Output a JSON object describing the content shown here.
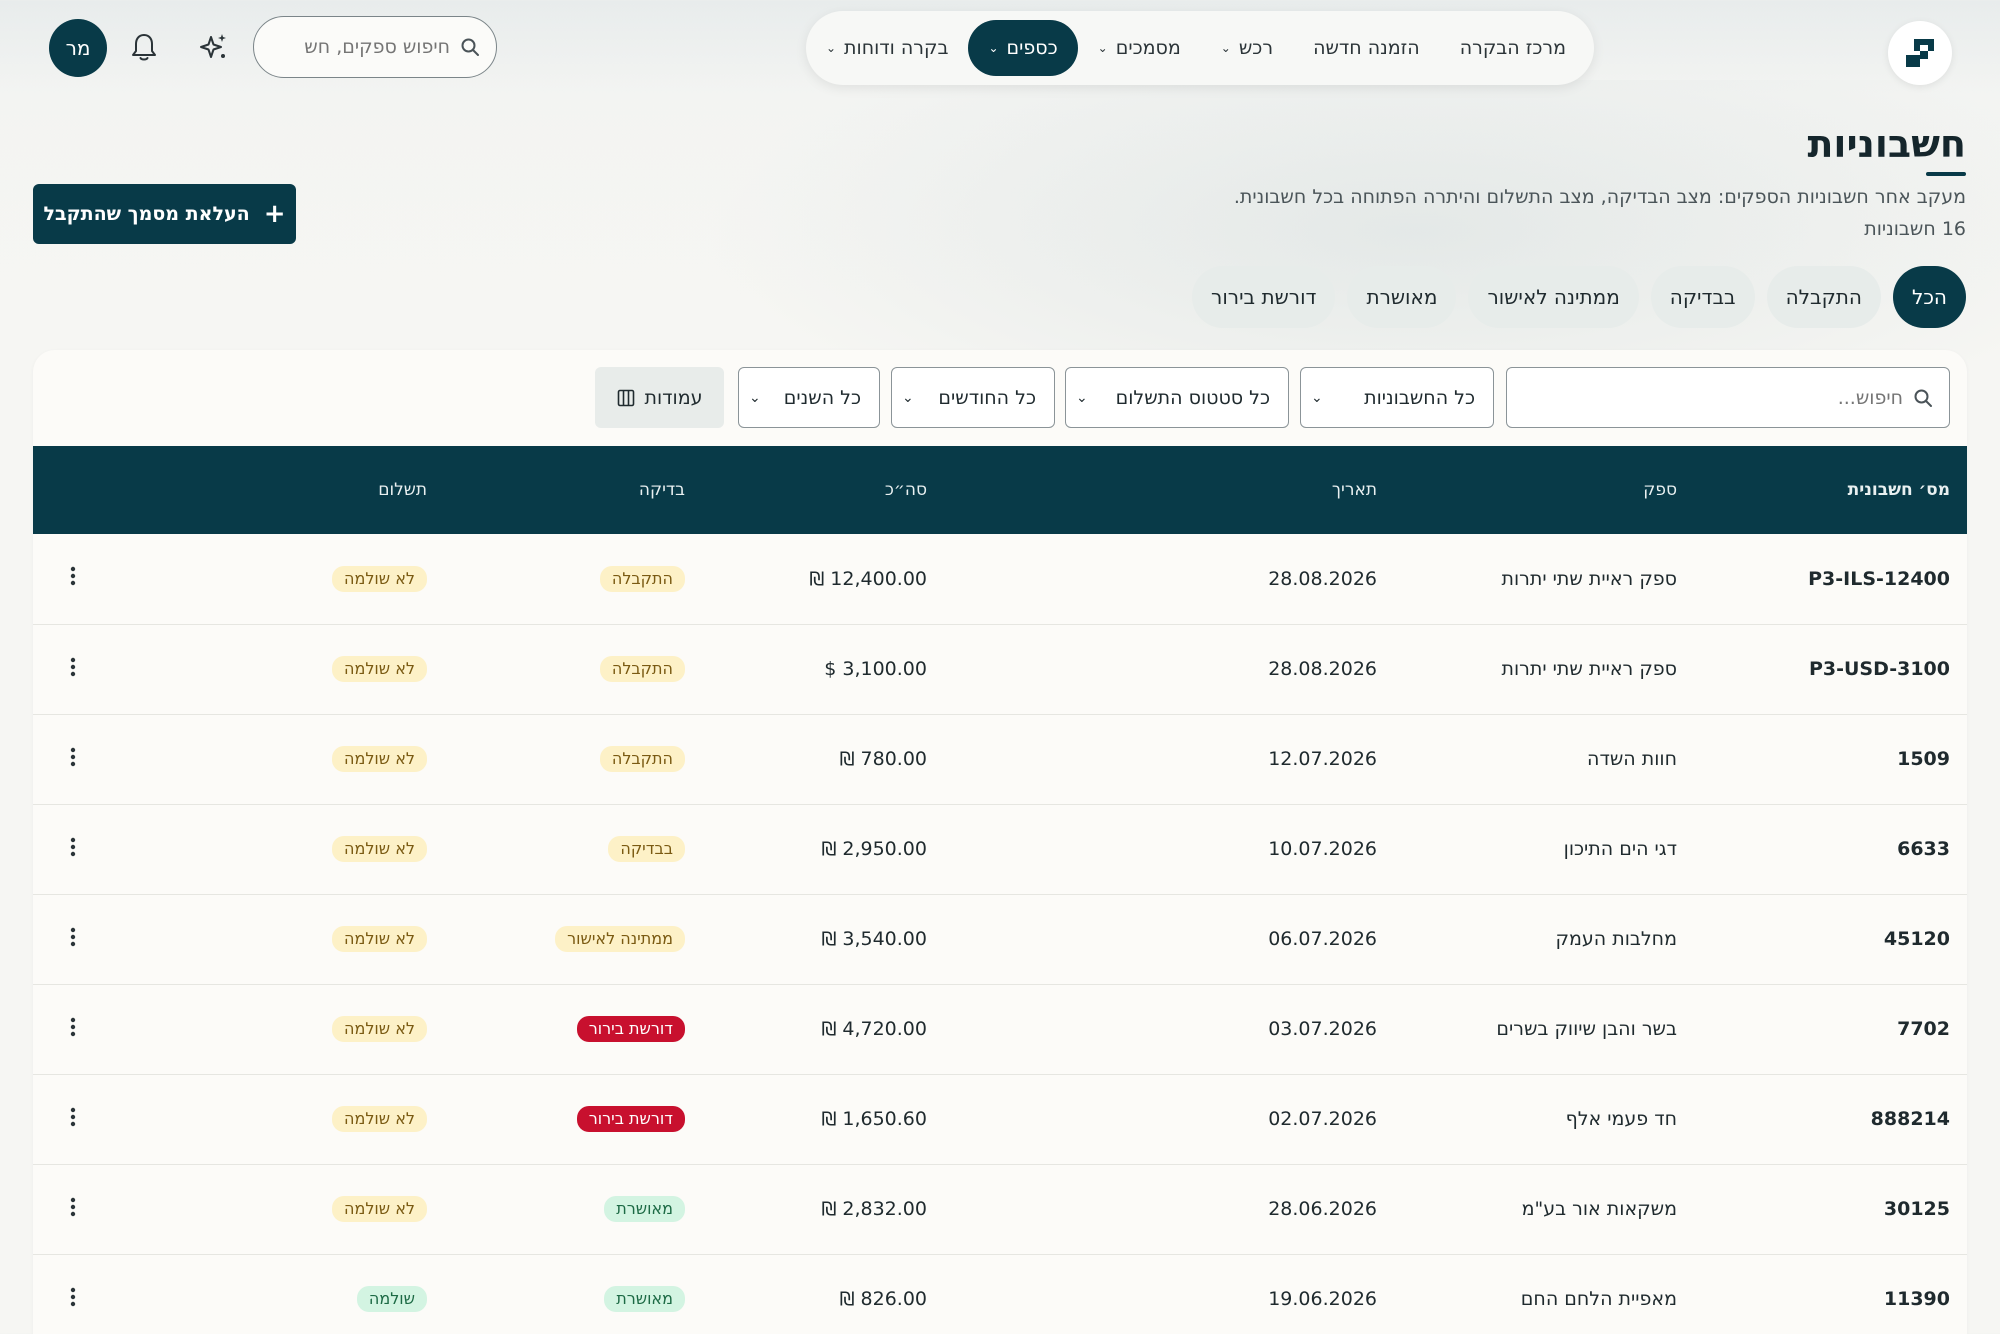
{
  "topbar": {
    "nav": [
      {
        "label": "מרכז הבקרה",
        "dropdown": false,
        "active": false
      },
      {
        "label": "הזמנה חדשה",
        "dropdown": false,
        "active": false
      },
      {
        "label": "רכש",
        "dropdown": true,
        "active": false
      },
      {
        "label": "מסמכים",
        "dropdown": true,
        "active": false
      },
      {
        "label": "כספים",
        "dropdown": true,
        "active": true
      },
      {
        "label": "בקרה ודוחות",
        "dropdown": true,
        "active": false
      }
    ],
    "search_placeholder": "חיפוש ספקים, חש",
    "avatar_initials": "מר",
    "icons": {
      "logo": "app-logo",
      "ai": "sparkles-icon",
      "notifications": "bell-icon",
      "search": "search-icon"
    }
  },
  "header": {
    "title": "חשבוניות",
    "subtitle": "מעקב אחר חשבוניות הספקים: מצב הבדיקה, מצב התשלום והיתרה הפתוחה בכל חשבונית.",
    "count": "16 חשבוניות",
    "upload_button": "העלאת מסמך שהתקבל"
  },
  "tabs": [
    "הכל",
    "התקבלה",
    "בבדיקה",
    "ממתינה לאישור",
    "מאושרת",
    "דורשת בירור"
  ],
  "active_tab": "הכל",
  "filters": {
    "search_placeholder": "חיפוש...",
    "invoices_select": "כל החשבוניות",
    "payment_status_select": "כל סטטוס התשלום",
    "months_select": "כל החודשים",
    "years_select": "כל השנים",
    "columns_button": "עמודות"
  },
  "table": {
    "headers": {
      "number": "מס׳ חשבונית",
      "supplier": "ספק",
      "date": "תאריך",
      "total": "סה״כ",
      "check": "בדיקה",
      "payment": "תשלום"
    },
    "rows": [
      {
        "number": "P3-ILS-12400",
        "supplier": "ספק ראיית שתי יתרות",
        "date": "28.08.2026",
        "total": "₪ 12,400.00",
        "check": "התקבלה",
        "check_type": "received",
        "payment": "לא שולמה",
        "payment_type": "unpaid"
      },
      {
        "number": "P3-USD-3100",
        "supplier": "ספק ראיית שתי יתרות",
        "date": "28.08.2026",
        "total": "$ 3,100.00",
        "check": "התקבלה",
        "check_type": "received",
        "payment": "לא שולמה",
        "payment_type": "unpaid"
      },
      {
        "number": "1509",
        "supplier": "חוות השדה",
        "date": "12.07.2026",
        "total": "₪ 780.00",
        "check": "התקבלה",
        "check_type": "received",
        "payment": "לא שולמה",
        "payment_type": "unpaid"
      },
      {
        "number": "6633",
        "supplier": "דגי הים התיכון",
        "date": "10.07.2026",
        "total": "₪ 2,950.00",
        "check": "בבדיקה",
        "check_type": "review",
        "payment": "לא שולמה",
        "payment_type": "unpaid"
      },
      {
        "number": "45120",
        "supplier": "מחלבות העמק",
        "date": "06.07.2026",
        "total": "₪ 3,540.00",
        "check": "ממתינה לאישור",
        "check_type": "pending",
        "payment": "לא שולמה",
        "payment_type": "unpaid"
      },
      {
        "number": "7702",
        "supplier": "בשר והבן שיווק בשרים",
        "date": "03.07.2026",
        "total": "₪ 4,720.00",
        "check": "דורשת בירור",
        "check_type": "clarify",
        "payment": "לא שולמה",
        "payment_type": "unpaid"
      },
      {
        "number": "888214",
        "supplier": "חד פעמי אלף",
        "date": "02.07.2026",
        "total": "₪ 1,650.60",
        "check": "דורשת בירור",
        "check_type": "clarify",
        "payment": "לא שולמה",
        "payment_type": "unpaid"
      },
      {
        "number": "30125",
        "supplier": "משקאות אור בע\"מ",
        "date": "28.06.2026",
        "total": "₪ 2,832.00",
        "check": "מאושרת",
        "check_type": "approved",
        "payment": "לא שולמה",
        "payment_type": "unpaid"
      },
      {
        "number": "11390",
        "supplier": "מאפיית הלחם החם",
        "date": "19.06.2026",
        "total": "₪ 826.00",
        "check": "מאושרת",
        "check_type": "approved",
        "payment": "שולמה",
        "payment_type": "paid"
      }
    ]
  },
  "colors": {
    "primary": "#083a48",
    "clarify": "#c8102e",
    "approved_bg": "#d3f4e2",
    "warning_bg": "#fdf1c7"
  }
}
